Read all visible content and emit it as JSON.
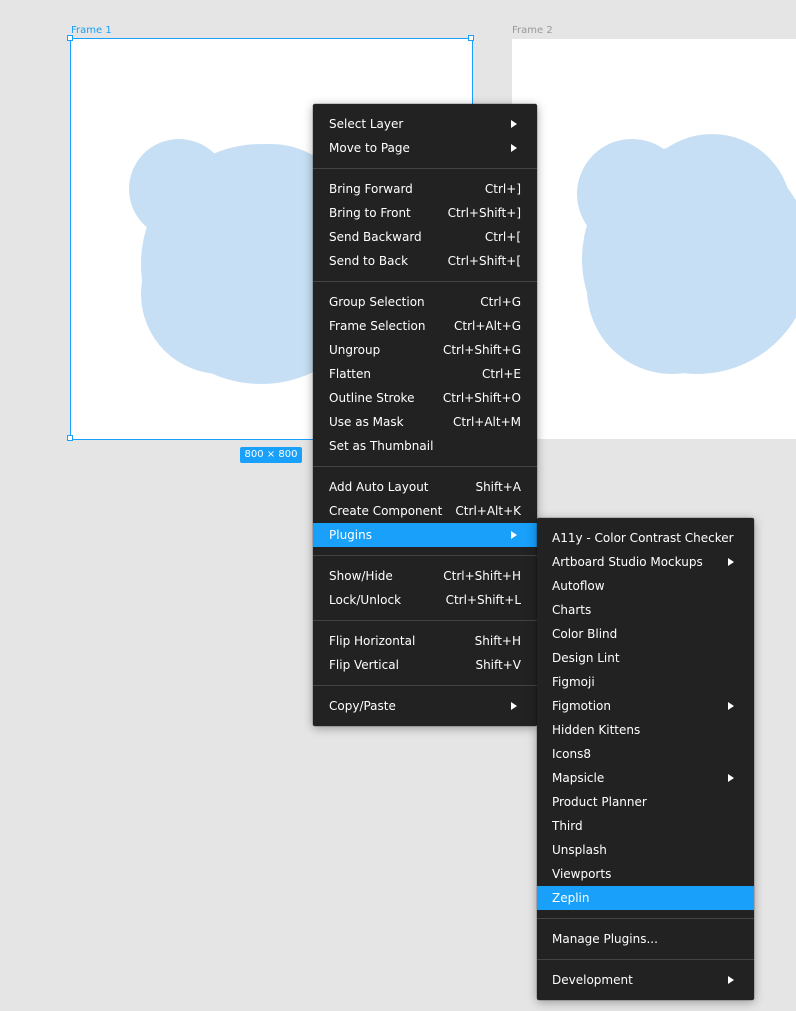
{
  "canvas": {
    "frames": [
      {
        "label": "Frame 1"
      },
      {
        "label": "Frame 2"
      }
    ],
    "selection_size": "800 × 800"
  },
  "colors": {
    "accent": "#18a0fb",
    "menu_bg": "#222222",
    "shape_fill": "#c7dff4",
    "canvas_bg": "#e5e5e5"
  },
  "context_menu": {
    "groups": [
      [
        {
          "label": "Select Layer",
          "submenu": true
        },
        {
          "label": "Move to Page",
          "submenu": true
        }
      ],
      [
        {
          "label": "Bring Forward",
          "shortcut": "Ctrl+]"
        },
        {
          "label": "Bring to Front",
          "shortcut": "Ctrl+Shift+]"
        },
        {
          "label": "Send Backward",
          "shortcut": "Ctrl+["
        },
        {
          "label": "Send to Back",
          "shortcut": "Ctrl+Shift+["
        }
      ],
      [
        {
          "label": "Group Selection",
          "shortcut": "Ctrl+G"
        },
        {
          "label": "Frame Selection",
          "shortcut": "Ctrl+Alt+G"
        },
        {
          "label": "Ungroup",
          "shortcut": "Ctrl+Shift+G"
        },
        {
          "label": "Flatten",
          "shortcut": "Ctrl+E"
        },
        {
          "label": "Outline Stroke",
          "shortcut": "Ctrl+Shift+O"
        },
        {
          "label": "Use as Mask",
          "shortcut": "Ctrl+Alt+M"
        },
        {
          "label": "Set as Thumbnail"
        }
      ],
      [
        {
          "label": "Add Auto Layout",
          "shortcut": "Shift+A"
        },
        {
          "label": "Create Component",
          "shortcut": "Ctrl+Alt+K"
        },
        {
          "label": "Plugins",
          "submenu": true,
          "highlighted": true
        }
      ],
      [
        {
          "label": "Show/Hide",
          "shortcut": "Ctrl+Shift+H"
        },
        {
          "label": "Lock/Unlock",
          "shortcut": "Ctrl+Shift+L"
        }
      ],
      [
        {
          "label": "Flip Horizontal",
          "shortcut": "Shift+H"
        },
        {
          "label": "Flip Vertical",
          "shortcut": "Shift+V"
        }
      ],
      [
        {
          "label": "Copy/Paste",
          "submenu": true
        }
      ]
    ]
  },
  "plugins_menu": {
    "groups": [
      [
        {
          "label": "A11y - Color Contrast Checker"
        },
        {
          "label": "Artboard Studio Mockups",
          "submenu": true
        },
        {
          "label": "Autoflow"
        },
        {
          "label": "Charts"
        },
        {
          "label": "Color Blind"
        },
        {
          "label": "Design Lint"
        },
        {
          "label": "Figmoji"
        },
        {
          "label": "Figmotion",
          "submenu": true
        },
        {
          "label": "Hidden Kittens"
        },
        {
          "label": "Icons8"
        },
        {
          "label": "Mapsicle",
          "submenu": true
        },
        {
          "label": "Product Planner"
        },
        {
          "label": "Third"
        },
        {
          "label": "Unsplash"
        },
        {
          "label": "Viewports"
        },
        {
          "label": "Zeplin",
          "highlighted": true
        }
      ],
      [
        {
          "label": "Manage Plugins..."
        }
      ],
      [
        {
          "label": "Development",
          "submenu": true
        }
      ]
    ]
  }
}
